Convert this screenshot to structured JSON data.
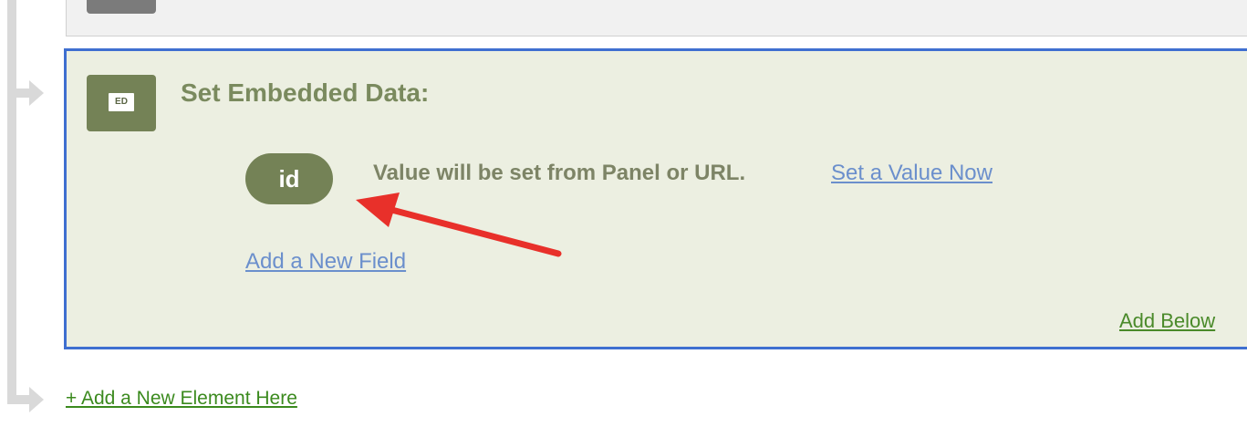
{
  "embedded_data_block": {
    "badge_text": "ED",
    "title": "Set Embedded Data:",
    "field": {
      "name": "id",
      "description": "Value will be set from Panel or URL.",
      "set_value_link": "Set a Value Now"
    },
    "add_field_link": "Add a New Field",
    "add_below_link": "Add Below"
  },
  "add_element_link": "+ Add a New Element Here",
  "colors": {
    "panel_background": "#ecefe1",
    "panel_border": "#3f6fd0",
    "badge_green": "#748256",
    "annotation_arrow": "#e8302a"
  },
  "icons": {
    "flow_arrow": "flow-arrow-icon",
    "annotation": "red-arrow-annotation"
  }
}
